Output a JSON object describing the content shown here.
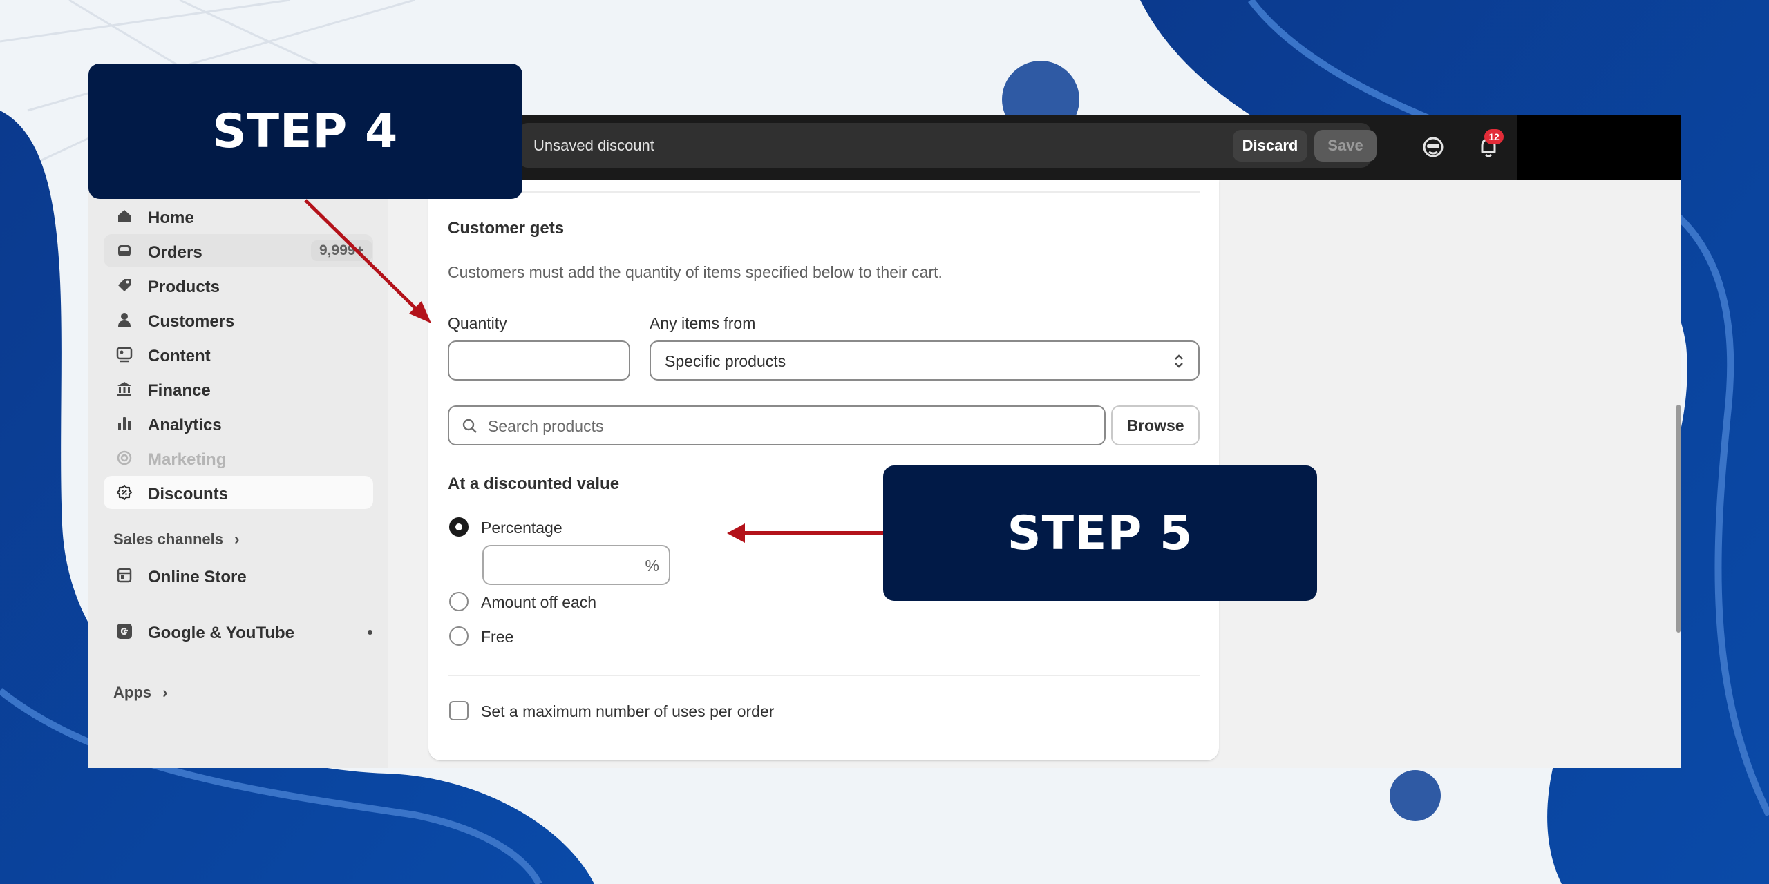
{
  "colors": {
    "step_box": "#011a47",
    "arrow": "#b3121a",
    "wave_dark": "#0a3b8c",
    "wave_light": "#3a74c8",
    "circle": "#2f5aa4"
  },
  "steps": {
    "step4": "STEP 4",
    "step5": "STEP 5"
  },
  "topbar": {
    "title": "Unsaved discount",
    "discard": "Discard",
    "save": "Save",
    "notification_count": "12",
    "icons": [
      "sidekick-icon",
      "bell-icon"
    ]
  },
  "sidebar": {
    "items": [
      {
        "label": "Home",
        "icon": "home-icon"
      },
      {
        "label": "Orders",
        "icon": "inbox-icon",
        "count": "9,999+"
      },
      {
        "label": "Products",
        "icon": "tag-icon"
      },
      {
        "label": "Customers",
        "icon": "person-icon"
      },
      {
        "label": "Content",
        "icon": "image-icon"
      },
      {
        "label": "Finance",
        "icon": "bank-icon"
      },
      {
        "label": "Analytics",
        "icon": "bar-chart-icon"
      },
      {
        "label": "Marketing",
        "icon": "target-icon"
      },
      {
        "label": "Discounts",
        "icon": "discount-icon"
      }
    ],
    "sales_channels": "Sales channels",
    "online_store": "Online Store",
    "google_youtube": "Google & YouTube",
    "apps": "Apps"
  },
  "customer_gets": {
    "heading": "Customer gets",
    "description": "Customers must add the quantity of items specified below to their cart.",
    "quantity_label": "Quantity",
    "quantity_value": "",
    "any_items_label": "Any items from",
    "any_items_value": "Specific products",
    "search_placeholder": "Search products",
    "browse": "Browse",
    "discounted_heading": "At a discounted value",
    "options": [
      "Percentage",
      "Amount off each",
      "Free"
    ],
    "selected_option": "Percentage",
    "percent_suffix": "%",
    "max_uses": "Set a maximum number of uses per order"
  }
}
